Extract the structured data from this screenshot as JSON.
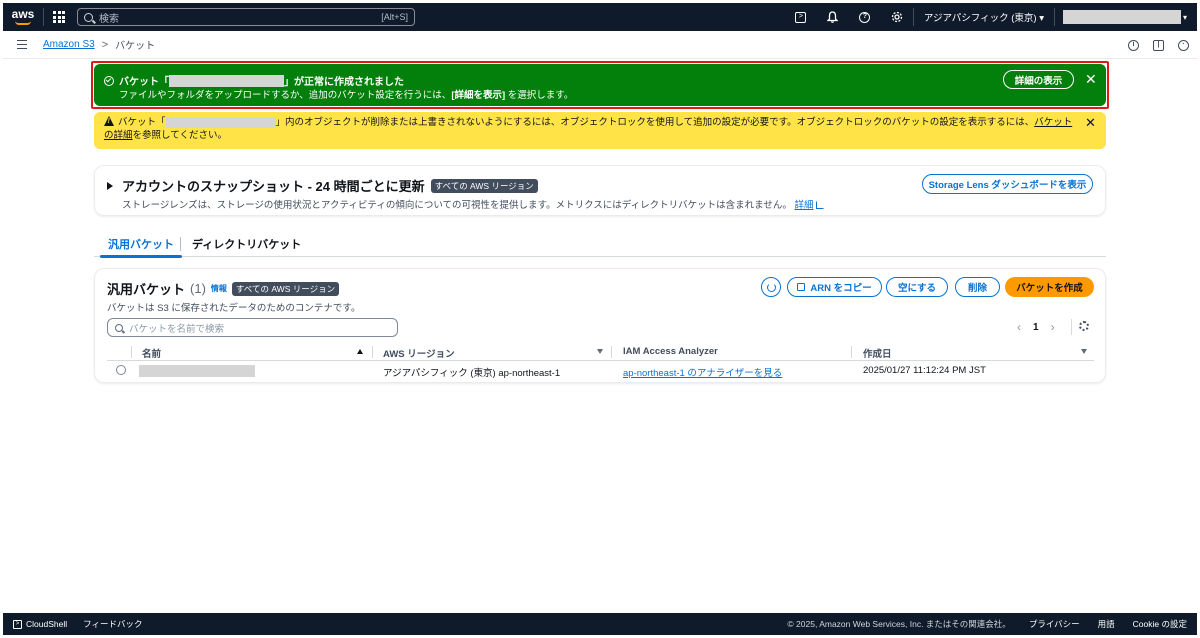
{
  "topnav": {
    "logo": "aws",
    "search_placeholder": "検索",
    "search_shortcut": "[Alt+S]",
    "cloudshell_icon": "terminal-icon",
    "notifications_icon": "bell-icon",
    "help_icon": "help-icon",
    "settings_icon": "gear-icon",
    "region": "アジアパシフィック (東京) ▾",
    "account_caret": "▾"
  },
  "breadcrumb": {
    "root": "Amazon S3",
    "separator": ">",
    "current": "バケット"
  },
  "success_flash": {
    "title_prefix": "バケット「",
    "title_suffix": "」が正常に作成されました",
    "body_prefix": "ファイルやフォルダをアップロードするか、追加のバケット設定を行うには、",
    "body_bold": "[詳細を表示]",
    "body_suffix": " を選択します。",
    "button": "詳細の表示",
    "close": "✕"
  },
  "warning_flash": {
    "prefix": "バケット「",
    "middle": "」内のオブジェクトが削除または上書きされないようにするには、オブジェクトロックを使用して追加の設定が必要です。オブジェクトロックのバケットの設定を表示するには、",
    "link": "バケットの詳細",
    "suffix": "を参照してください。",
    "close": "✕"
  },
  "snapshot": {
    "title": "アカウントのスナップショット - 24 時間ごとに更新",
    "badge": "すべての AWS リージョン",
    "description": "ストレージレンズは、ストレージの使用状況とアクティビティの傾向についての可視性を提供します。メトリクスにはディレクトリバケットは含まれません。",
    "link": "詳細",
    "button": "Storage Lens ダッシュボードを表示"
  },
  "tabs": [
    {
      "label": "汎用バケット"
    },
    {
      "label": "ディレクトリバケット"
    }
  ],
  "buckets_panel": {
    "title": "汎用バケット",
    "count": "(1)",
    "info": "情報",
    "badge": "すべての AWS リージョン",
    "description": "バケットは S3 に保存されたデータのためのコンテナです。",
    "btn_copy_arn": "ARN をコピー",
    "btn_empty": "空にする",
    "btn_delete": "削除",
    "btn_create": "バケットを作成",
    "search_placeholder": "バケットを名前で検索",
    "page_prev": "‹",
    "page_number": "1",
    "page_next": "›"
  },
  "table": {
    "columns": [
      "名前",
      "AWS リージョン",
      "IAM Access Analyzer",
      "作成日"
    ],
    "rows": [
      {
        "region": "アジアパシフィック (東京) ap-northeast-1",
        "analyzer": "ap-northeast-1 のアナライザーを見る",
        "created": "2025/01/27 11:12:24 PM JST"
      }
    ]
  },
  "footer": {
    "cloudshell": "CloudShell",
    "feedback": "フィードバック",
    "copyright": "© 2025, Amazon Web Services, Inc. またはその関連会社。",
    "privacy": "プライバシー",
    "terms": "用語",
    "cookie": "Cookie の設定"
  },
  "colors": {
    "nav_bg": "#0f1b2a",
    "success": "#037f0c",
    "warning": "#ffe347",
    "link": "#0972d3",
    "primary": "#ff9900",
    "highlight_outline": "#e0191d"
  }
}
